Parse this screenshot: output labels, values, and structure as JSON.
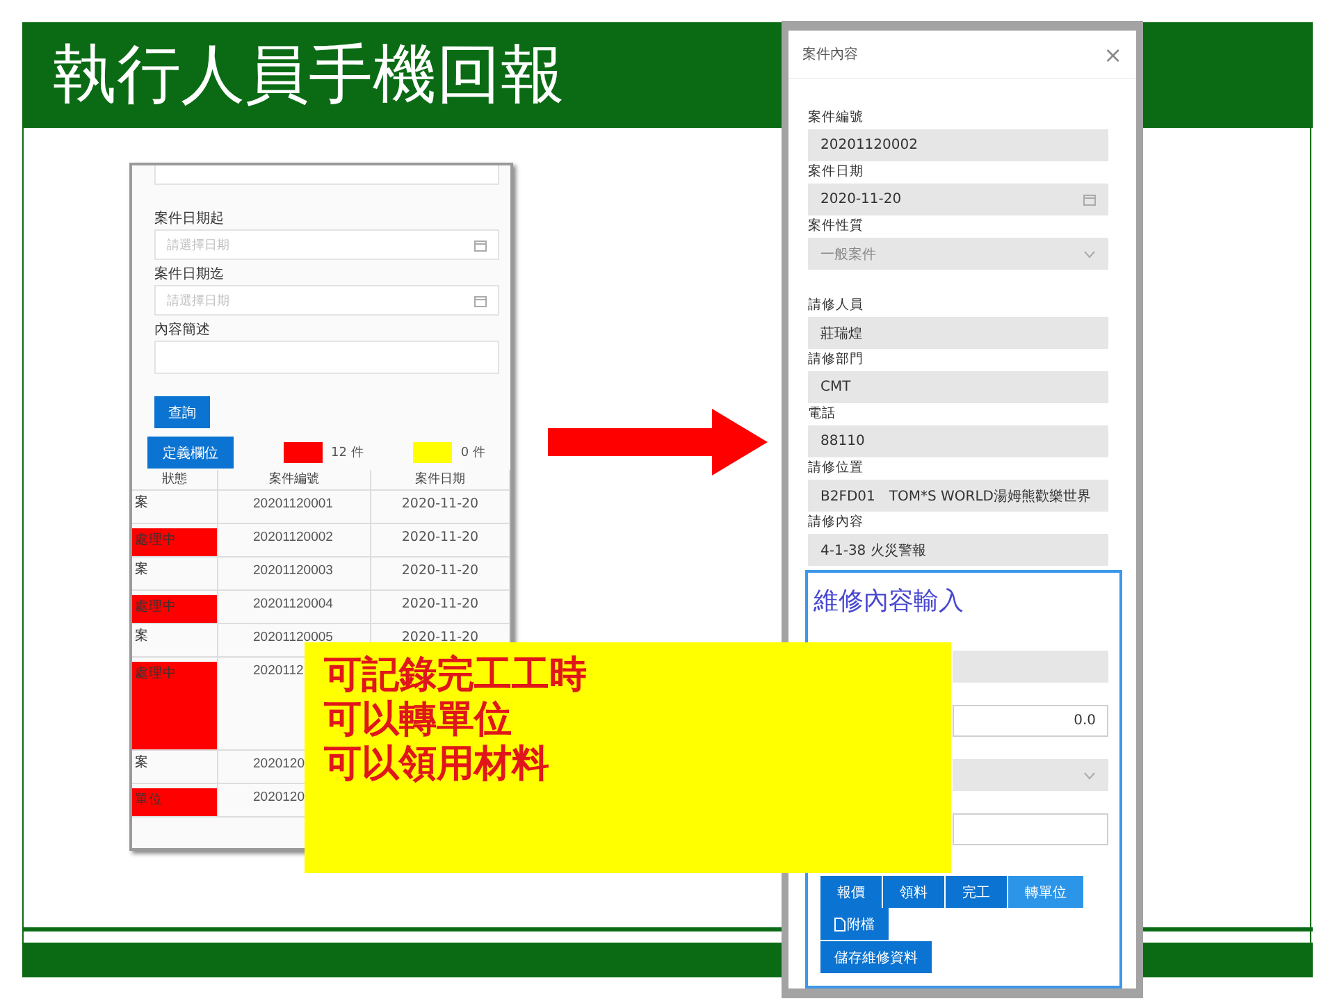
{
  "slide": {
    "title": "執行人員手機回報"
  },
  "search_screen": {
    "fields": [
      {
        "kind": "text"
      },
      {
        "kind": "date",
        "label": "案件日期起",
        "placeholder": "請選擇日期"
      },
      {
        "kind": "date",
        "label": "案件日期迄",
        "placeholder": "請選擇日期"
      },
      {
        "kind": "text",
        "label": "內容簡述"
      }
    ],
    "query_button": "查詢",
    "columns_button": "定義欄位",
    "legend": [
      {
        "color": "#ff0000",
        "count": "12 件"
      },
      {
        "color": "#ffff00",
        "count": "0 件"
      }
    ],
    "table": {
      "columns": [
        "狀態",
        "案件編號",
        "案件日期"
      ],
      "rows": [
        {
          "status": "案",
          "case_no": "20201120001",
          "date": "2020-11-20",
          "highlighted": false
        },
        {
          "status": "處理中",
          "case_no": "20201120002",
          "date": "2020-11-20",
          "highlighted": true
        },
        {
          "status": "案",
          "case_no": "20201120003",
          "date": "2020-11-20",
          "highlighted": false
        },
        {
          "status": "處理中",
          "case_no": "20201120004",
          "date": "2020-11-20",
          "highlighted": true
        },
        {
          "status": "案",
          "case_no": "20201120005",
          "date": "2020-11-20",
          "highlighted": false
        },
        {
          "status": "處理中",
          "case_no": "2020112",
          "highlighted": true,
          "tall": true
        },
        {
          "status": "案",
          "case_no": "2020120",
          "highlighted": false
        },
        {
          "status": "單位",
          "case_no": "2020120",
          "highlighted": true
        }
      ]
    }
  },
  "callout": {
    "lines": [
      "可記錄完工工時",
      "可以轉單位",
      "可以領用材料"
    ]
  },
  "case_dialog": {
    "title": "案件內容",
    "close": "×",
    "fields": [
      {
        "kind": "text",
        "label": "案件編號",
        "value": "20201120002",
        "disabled": false
      },
      {
        "kind": "date",
        "label": "案件日期",
        "value": "2020-11-20",
        "disabled": false
      },
      {
        "kind": "select",
        "label": "案件性質",
        "value": "一般案件",
        "disabled": true
      },
      {
        "kind": "text",
        "label": "請修人員",
        "value": "莊瑞煌",
        "disabled": false
      },
      {
        "kind": "text",
        "label": "請修部門",
        "value": "CMT",
        "disabled": false
      },
      {
        "kind": "text",
        "label": "電話",
        "value": "88110",
        "disabled": false
      },
      {
        "kind": "text",
        "label": "請修位置",
        "value": "B2FD01　TOM*S WORLD湯姆熊歡樂世界",
        "disabled": false
      },
      {
        "kind": "text",
        "label": "請修內容",
        "value": "4-1-38 火災警報",
        "disabled": false
      }
    ],
    "repair_section": {
      "title": "維修內容輸入",
      "inputs": [
        {
          "kind": "text",
          "disabled": true
        },
        {
          "kind": "number",
          "value": "0.0",
          "disabled": false
        },
        {
          "kind": "select",
          "disabled": true
        },
        {
          "kind": "text",
          "disabled": false
        }
      ],
      "actions": [
        {
          "label": "報價",
          "highlighted": false
        },
        {
          "label": "領料",
          "highlighted": false
        },
        {
          "label": "完工",
          "highlighted": false
        },
        {
          "label": "轉單位",
          "highlighted": true
        }
      ],
      "attach_button": "附檔",
      "save_button": "儲存維修資料"
    }
  }
}
